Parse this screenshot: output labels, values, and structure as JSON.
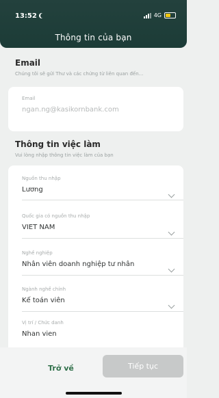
{
  "status_bar": {
    "time": "13:52",
    "network": "4G"
  },
  "header": {
    "title": "Thông tin của bạn"
  },
  "email_section": {
    "title": "Email",
    "subtitle": "Chúng tôi sẽ gửi Thư và các chứng từ liên quan đến...",
    "field_label": "Email",
    "field_value": "ngan.ng@kasikornbank.com"
  },
  "job_section": {
    "title": "Thông tin việc làm",
    "subtitle": "Vui lòng nhập thông tin việc làm của bạn",
    "fields": [
      {
        "label": "Nguồn thu nhập",
        "value": "Lương"
      },
      {
        "label": "Quốc gia có nguồn thu nhập",
        "value": "VIET NAM"
      },
      {
        "label": "Nghề nghiệp",
        "value": "Nhân viên doanh nghiệp tư nhân"
      },
      {
        "label": "Ngành nghề chính",
        "value": "Kế toán viên"
      },
      {
        "label": "Vị trí / Chức danh",
        "value": "Nhan vien"
      }
    ]
  },
  "buttons": {
    "back": "Trở về",
    "next": "Tiếp tục"
  }
}
